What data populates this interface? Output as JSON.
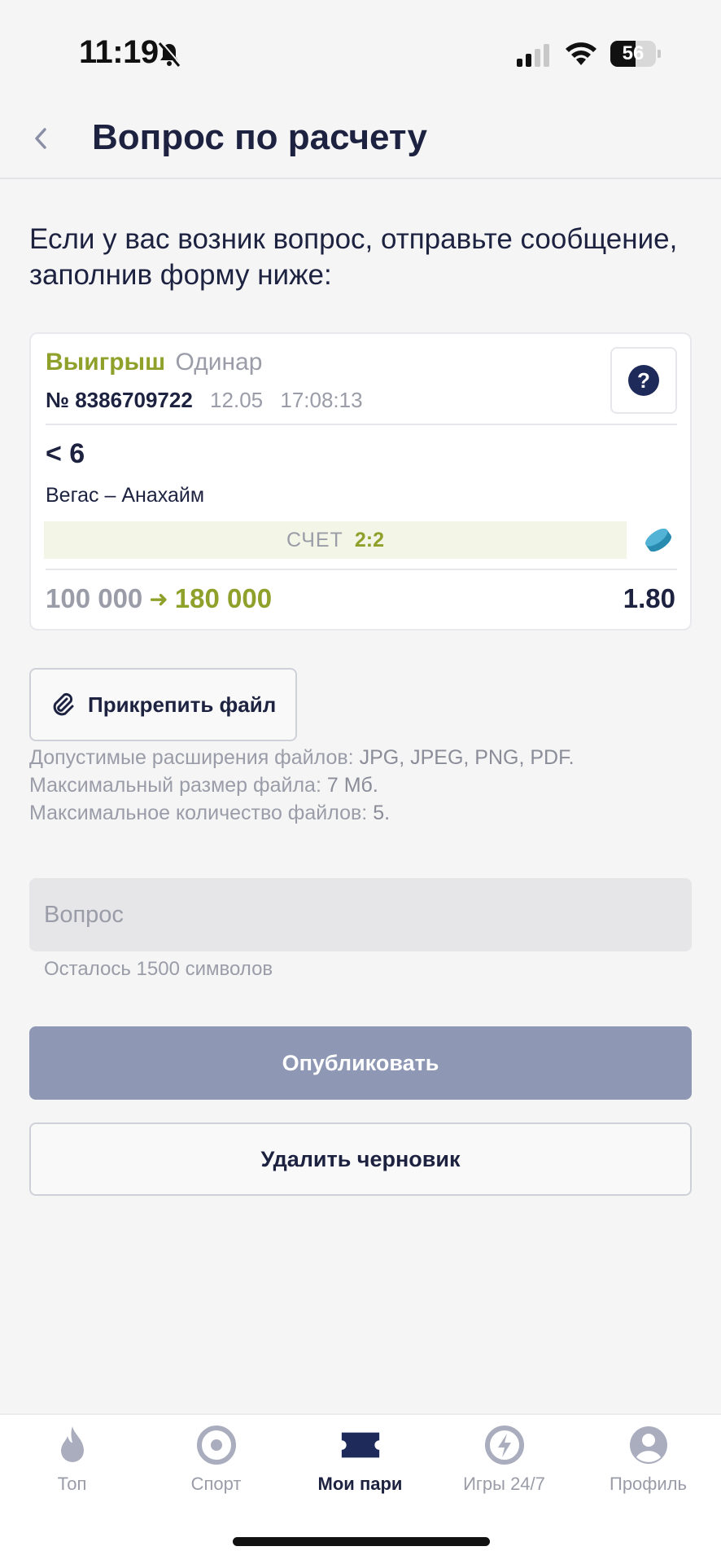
{
  "status_bar": {
    "time": "11:19",
    "battery": "56",
    "battery_level": 0.56
  },
  "header": {
    "title": "Вопрос по расчету"
  },
  "intro_text": "Если у вас возник вопрос, отправьте сообщение, заполнив форму ниже:",
  "bet": {
    "result": "Выигрыш",
    "type": "Одинар",
    "number": "№ 8386709722",
    "date": "12.05",
    "time": "17:08:13",
    "outcome": "< 6",
    "event": "Вегас – Анахайм",
    "score_label": "СЧЕТ",
    "score": "2:2",
    "stake": "100 000",
    "payout": "180 000",
    "odds": "1.80",
    "sport_icon": "hockey-puck-icon"
  },
  "attach": {
    "button_label": "Прикрепить файл",
    "info_lines": [
      {
        "prefix": "Допустимые расширения файлов: ",
        "value": "JPG, JPEG, PNG, PDF."
      },
      {
        "prefix": "Максимальный размер файла: ",
        "value": "7 Мб."
      },
      {
        "prefix": "Максимальное количество файлов: ",
        "value": "5."
      }
    ]
  },
  "question": {
    "placeholder": "Вопрос",
    "value": "",
    "chars_left": "Осталось 1500 символов"
  },
  "buttons": {
    "publish": "Опубликовать",
    "delete_draft": "Удалить черновик"
  },
  "tabbar": {
    "items": [
      {
        "label": "Топ",
        "icon": "flame-icon",
        "active": false
      },
      {
        "label": "Спорт",
        "icon": "target-icon",
        "active": false
      },
      {
        "label": "Мои пари",
        "icon": "ticket-icon",
        "active": true
      },
      {
        "label": "Игры 24/7",
        "icon": "lightning-icon",
        "active": false
      },
      {
        "label": "Профиль",
        "icon": "profile-icon",
        "active": false
      }
    ]
  },
  "colors": {
    "accent_green": "#8fa12a",
    "primary_dark": "#1d2240",
    "muted": "#9a9ca8",
    "publish_bg": "#8e97b3"
  }
}
